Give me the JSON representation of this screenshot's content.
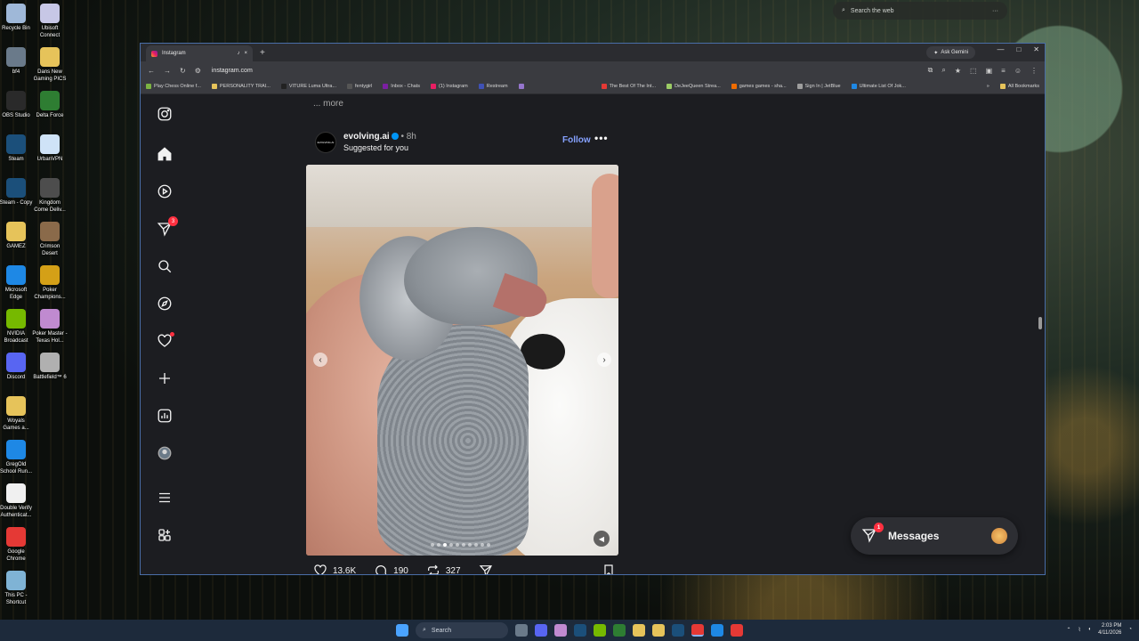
{
  "desktop": {
    "icons": [
      {
        "label": "Recycle Bin",
        "color": "#9fb8d8"
      },
      {
        "label": "Ubisoft Connect",
        "color": "#c7c7e6"
      },
      {
        "label": "bf4",
        "color": "#6a7a8a"
      },
      {
        "label": "Dans New Gaming PICS",
        "color": "#e6c35a"
      },
      {
        "label": "OBS Studio",
        "color": "#2a2a2a"
      },
      {
        "label": "Delta Force",
        "color": "#2e7d32"
      },
      {
        "label": "Steam",
        "color": "#1b4f7a"
      },
      {
        "label": "UrbanVPN",
        "color": "#cfe3f7"
      },
      {
        "label": "Steam - Copy",
        "color": "#1b4f7a"
      },
      {
        "label": "Kingdom Come Deliv...",
        "color": "#4d4d4d"
      },
      {
        "label": "GAMEZ",
        "color": "#e6c35a"
      },
      {
        "label": "Crimson Desert",
        "color": "#8a6a4a"
      },
      {
        "label": "Microsoft Edge",
        "color": "#1e88e5"
      },
      {
        "label": "Poker Champions...",
        "color": "#d4a017"
      },
      {
        "label": "NVIDIA Broadcast",
        "color": "#76b900"
      },
      {
        "label": "Poker Master - Texas Hol...",
        "color": "#c08ad0"
      },
      {
        "label": "Discord",
        "color": "#5865f2"
      },
      {
        "label": "Battlefield™ 6",
        "color": "#b0b0b0"
      },
      {
        "label": "Woyals Games a...",
        "color": "#e6c35a"
      },
      {
        "label": "GregOld School Run...",
        "color": "#1e88e5"
      },
      {
        "label": "Double Verify Authenticat...",
        "color": "#f0f0f0"
      },
      {
        "label": "Google Chrome",
        "color": "#e53935"
      },
      {
        "label": "This PC - Shortcut",
        "color": "#7fb3d5"
      }
    ]
  },
  "web_search": {
    "placeholder": "Search the web",
    "more": "···"
  },
  "browser": {
    "tab_title": "Instagram",
    "tab_close": "×",
    "new_tab": "+",
    "ask_gemini": "Ask Gemini",
    "window_controls": [
      "—",
      "□",
      "✕"
    ],
    "url": "instagram.com",
    "bookmarks": [
      "Play Chess Online f...",
      "PERSONALITY TRAI...",
      "VITURE Luma Ultra...",
      "fentygirl",
      "Inbox - Chats",
      "(1) Instagram",
      "Restream",
      "",
      "The Best Of The Int...",
      "DeJeeQueen Strea...",
      "games games - sha...",
      "Sign In | JetBlue",
      "Ultimate List Of Jok...",
      "All Bookmarks"
    ]
  },
  "instagram": {
    "sidebar": {
      "direct_badge": "3"
    },
    "caption_more": "... more",
    "post": {
      "avatar_text": "EVOLVING.AI",
      "username": "evolving.ai",
      "time": "• 8h",
      "subtitle": "Suggested for you",
      "follow": "Follow",
      "options": "•••",
      "likes": "13.6K",
      "comments": "190",
      "reposts": "327",
      "carousel_count": 10,
      "carousel_active": 2
    },
    "messages": {
      "label": "Messages",
      "badge": "1"
    }
  },
  "taskbar": {
    "search": "Search",
    "time": "2:03 PM",
    "date": "4/11/2026"
  }
}
